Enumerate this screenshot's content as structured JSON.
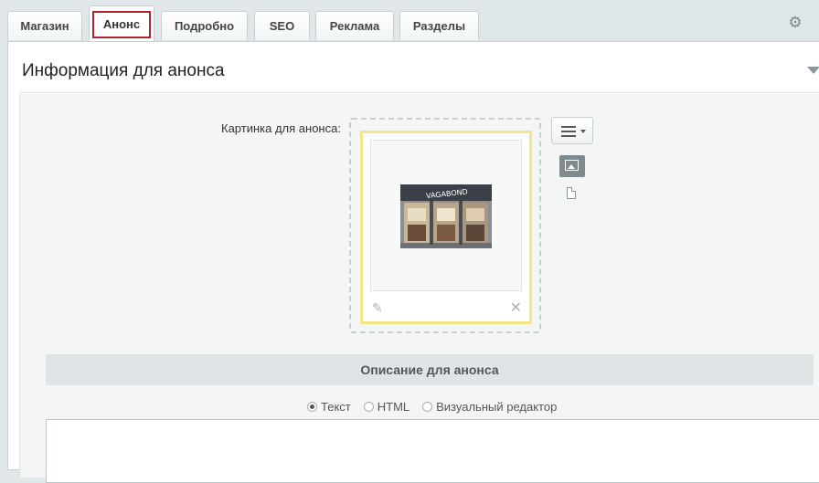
{
  "tabs": [
    {
      "label": "Магазин"
    },
    {
      "label": "Анонс"
    },
    {
      "label": "Подробно"
    },
    {
      "label": "SEO"
    },
    {
      "label": "Реклама"
    },
    {
      "label": "Разделы"
    }
  ],
  "active_tab": "Анонс",
  "section": {
    "title": "Информация для анонса"
  },
  "picture": {
    "label": "Картинка для анонса:",
    "alt": "VAGABOND"
  },
  "description": {
    "header": "Описание для анонса",
    "modes": [
      {
        "label": "Текст",
        "checked": true
      },
      {
        "label": "HTML",
        "checked": false
      },
      {
        "label": "Визуальный редактор",
        "checked": false
      }
    ],
    "value": ""
  },
  "colors": {
    "active_tab_outline": "#a8262d",
    "picture_frame": "#f5e58a"
  },
  "icons": [
    "gear-icon",
    "collapse-arrow-icon",
    "pencil-icon",
    "close-icon",
    "menu-icon",
    "image-icon",
    "file-icon"
  ]
}
